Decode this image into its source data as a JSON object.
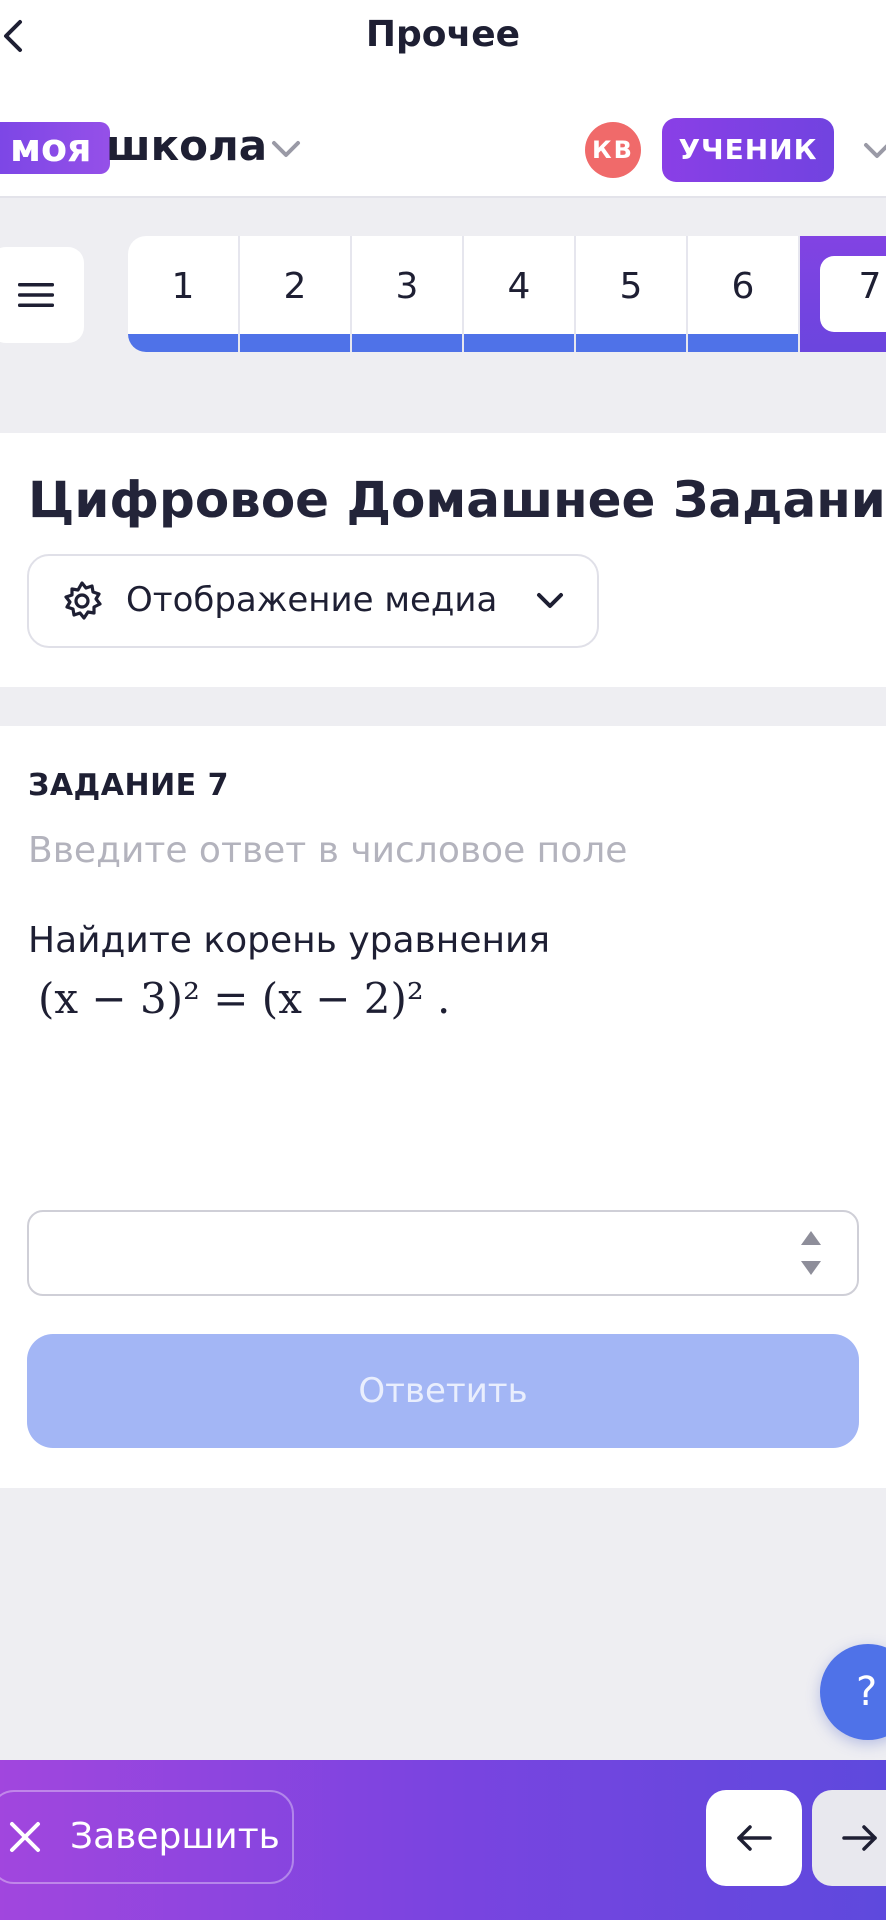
{
  "topbar": {
    "title": "Прочее"
  },
  "school": {
    "logo_part1": "моя",
    "logo_part2": "школа"
  },
  "user": {
    "initials": "КВ",
    "role": "УЧЕНИК"
  },
  "task_nav": {
    "tabs": [
      {
        "label": "1",
        "done": true
      },
      {
        "label": "2",
        "done": true
      },
      {
        "label": "3",
        "done": true
      },
      {
        "label": "4",
        "done": true
      },
      {
        "label": "5",
        "done": true
      },
      {
        "label": "6",
        "done": true
      },
      {
        "label": "7",
        "active": true
      }
    ]
  },
  "page": {
    "title": "Цифровое Домашнее Задание",
    "media_dropdown": "Отображение медиа"
  },
  "task": {
    "label": "ЗАДАНИЕ 7",
    "hint": "Введите ответ в числовое поле",
    "question": "Найдите корень уравнения",
    "equation": "(x − 3)² = (x − 2)² .",
    "answer_value": "",
    "submit_label": "Ответить"
  },
  "help": {
    "label": "?"
  },
  "bottom": {
    "finish_label": "Завершить"
  },
  "colors": {
    "accent_purple": "#7B46E6",
    "accent_blue": "#4F72E8",
    "avatar_red": "#F06A6A",
    "submit_disabled": "#A3B6F5"
  },
  "icons": [
    "back-icon",
    "chevron-down-icon",
    "menu-icon",
    "gear-icon",
    "stepper-icon",
    "close-icon",
    "arrow-left-icon",
    "arrow-right-icon"
  ]
}
